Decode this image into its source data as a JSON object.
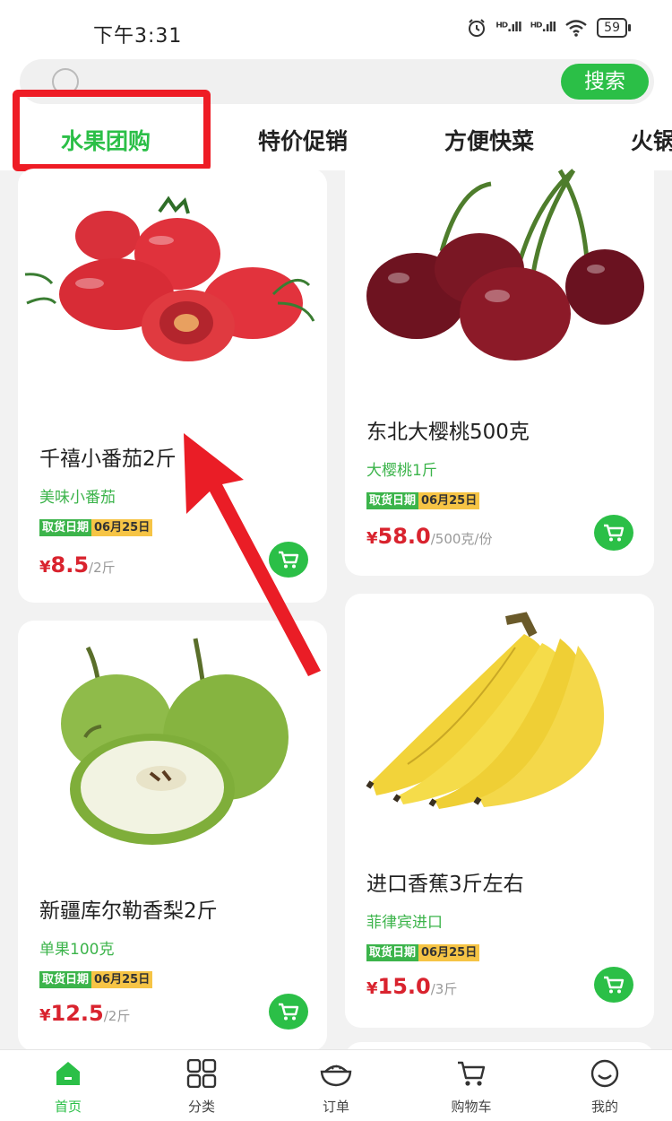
{
  "status_bar": {
    "time": "下午3:31",
    "signal1": "ᴴᴰ.ıll",
    "signal2": "ᴴᴰ.ıll",
    "battery": "59"
  },
  "search": {
    "button_label": "搜索"
  },
  "tabs": [
    {
      "label": "水果团购",
      "active": true
    },
    {
      "label": "特价促销",
      "active": false
    },
    {
      "label": "方便快菜",
      "active": false
    },
    {
      "label": "火锅",
      "active": false
    }
  ],
  "products": [
    {
      "title": "千禧小番茄2斤",
      "subtitle": "美味小番茄",
      "date_label": "取货日期",
      "date": "06月25日",
      "price_symbol": "¥",
      "price": "8.5",
      "unit": "/2斤",
      "image": "cherry-tomatoes"
    },
    {
      "title": "东北大樱桃500克",
      "subtitle": "大樱桃1斤",
      "date_label": "取货日期",
      "date": "06月25日",
      "price_symbol": "¥",
      "price": "58.0",
      "unit": "/500克/份",
      "image": "cherries"
    },
    {
      "title": "新疆库尔勒香梨2斤",
      "subtitle": "单果100克",
      "date_label": "取货日期",
      "date": "06月25日",
      "price_symbol": "¥",
      "price": "12.5",
      "unit": "/2斤",
      "image": "pears"
    },
    {
      "title": "进口香蕉3斤左右",
      "subtitle": "菲律宾进口",
      "date_label": "取货日期",
      "date": "06月25日",
      "price_symbol": "¥",
      "price": "15.0",
      "unit": "/3斤",
      "image": "bananas"
    }
  ],
  "bottom_nav": [
    {
      "label": "首页",
      "icon": "home-icon",
      "active": true
    },
    {
      "label": "分类",
      "icon": "grid-icon",
      "active": false
    },
    {
      "label": "订单",
      "icon": "bowl-icon",
      "active": false
    },
    {
      "label": "购物车",
      "icon": "cart-icon",
      "active": false
    },
    {
      "label": "我的",
      "icon": "smile-icon",
      "active": false
    }
  ],
  "colors": {
    "accent": "#2bbf47",
    "price": "#d9232e",
    "highlight": "#ee1c25",
    "date_tag": "#f6c445"
  }
}
